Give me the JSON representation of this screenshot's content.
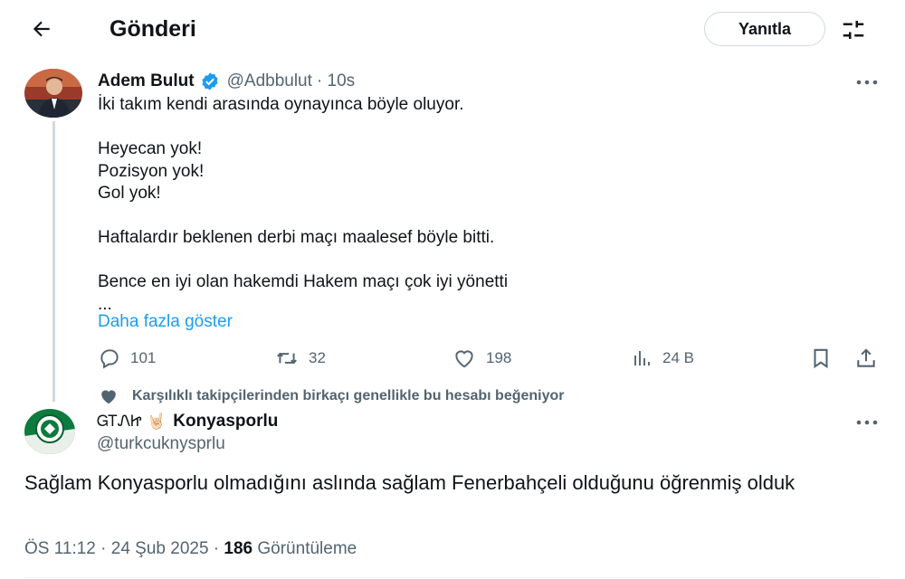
{
  "header": {
    "title": "Gönderi",
    "reply_button": "Yanıtla",
    "back_icon": "arrow-left-icon",
    "tune_icon": "sliders-icon"
  },
  "parent_tweet": {
    "name": "Adem Bulut",
    "handle": "@Adbbulut",
    "time": "· 10s",
    "text_lines": [
      "İki takım kendi arasında oynayınca böyle oluyor.",
      "",
      "Heyecan yok!",
      "Pozisyon yok!",
      "Gol yok!",
      "",
      "Haftalardır beklenen derbi maçı maalesef böyle bitti.",
      "",
      "Bence en iyi olan hakemdi Hakem maçı çok iyi yönetti",
      "..."
    ],
    "show_more": "Daha fazla göster",
    "actions": {
      "replies": "101",
      "reposts": "32",
      "likes": "198",
      "views": "24 B"
    }
  },
  "social_context": "Karşılıklı takipçilerinden birkaçı genellikle bu hesabı beğeniyor",
  "main_tweet": {
    "name_prefix": "ᏀᎢᏁᏥ 🤘🏻",
    "name": "Konyasporlu",
    "handle": "@turkcuknysprlu",
    "text": "Sağlam Konyasporlu olmadığını aslında sağlam  Fenerbahçeli olduğunu öğrenmiş olduk",
    "timestamp": "ÖS 11:12 · 24 Şub 2025 · ",
    "views_count": "186",
    "views_label": " Görüntüleme"
  },
  "colors": {
    "accent": "#1d9bf0",
    "text": "#0f1419",
    "secondary": "#536471",
    "border": "#cfd9de"
  }
}
